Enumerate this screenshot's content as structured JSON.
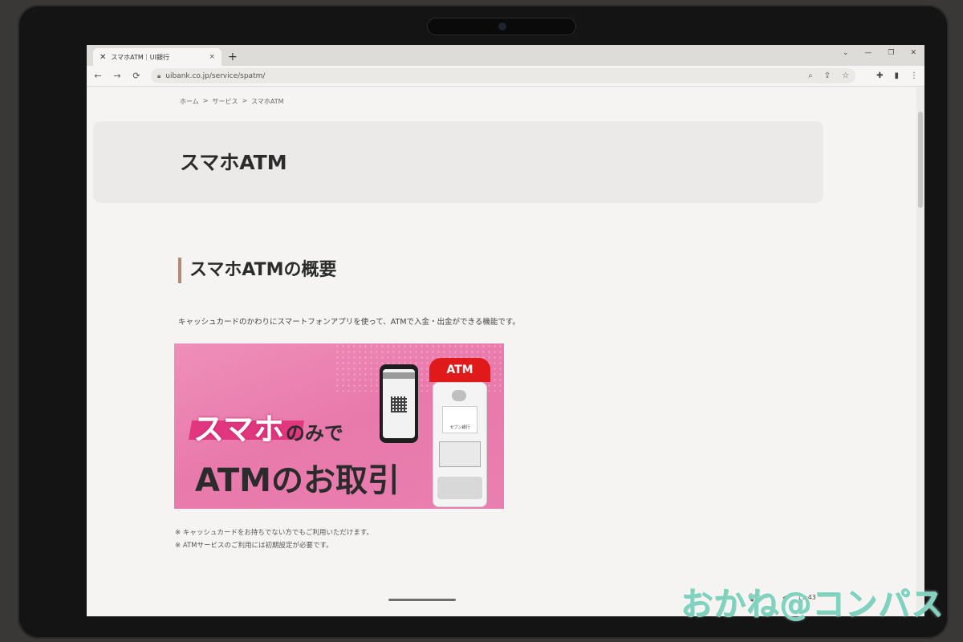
{
  "browser": {
    "tab_title": "スマホATM｜UI銀行",
    "tab_favicon": "✕",
    "tab_close": "×",
    "new_tab": "+",
    "url": "uibank.co.jp/service/spatm/",
    "window_controls": [
      "⌄",
      "—",
      "❐",
      "✕"
    ],
    "nav": {
      "back": "←",
      "forward": "→",
      "reload": "⟳"
    },
    "omni_icons": [
      "⌕",
      "⇪",
      "☆"
    ],
    "tool_icons": [
      "✚",
      "▮",
      "⋮"
    ]
  },
  "breadcrumb": [
    "ホーム",
    ">",
    "サービス",
    ">",
    "スマホATM"
  ],
  "page": {
    "title": "スマホATM",
    "section_heading": "スマホATMの概要",
    "intro": "キャッシュカードのかわりにスマートフォンアプリを使って、ATMで入金・出金ができる機能です。",
    "notes": [
      "※ キャッシュカードをお持ちでない方でもご利用いただけます。",
      "※ ATMサービスのご利用には初期設定が必要です。"
    ]
  },
  "banner": {
    "line1_highlight": "スマホ",
    "line1_rest": "のみで",
    "line2": "ATMのお取引",
    "atm_label": "ATM",
    "atm_logo_text": "セブン銀行"
  },
  "taskbar": {
    "time": "11:43"
  },
  "watermark": "おかね@コンパス",
  "colors": {
    "accent_bar": "#b58a72",
    "banner_pink": "#e879ab",
    "atm_red": "#e01a1a",
    "watermark": "#7fd3be"
  }
}
